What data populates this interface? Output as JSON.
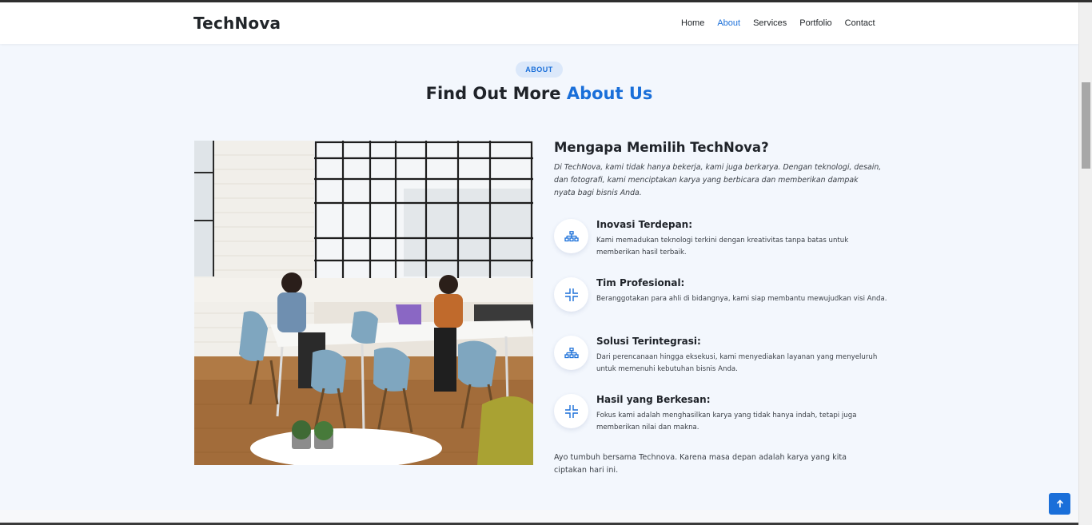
{
  "nav": {
    "brand": "TechNova",
    "links": [
      {
        "label": "Home",
        "active": false
      },
      {
        "label": "About",
        "active": true
      },
      {
        "label": "Services",
        "active": false
      },
      {
        "label": "Portfolio",
        "active": false
      },
      {
        "label": "Contact",
        "active": false
      }
    ]
  },
  "section": {
    "badge": "ABOUT",
    "title_plain": "Find Out More ",
    "title_accent": "About Us"
  },
  "about": {
    "heading": "Mengapa Memilih TechNova?",
    "intro": "Di TechNova, kami tidak hanya bekerja, kami juga berkarya. Dengan teknologi, desain, dan fotografi, kami menciptakan karya yang berbicara dan memberikan dampak nyata bagi bisnis Anda.",
    "features": [
      {
        "icon": "diagram-icon",
        "title": "Inovasi Terdepan:",
        "desc": "Kami memadukan teknologi terkini dengan kreativitas tanpa batas untuk memberikan hasil terbaik."
      },
      {
        "icon": "compress-icon",
        "title": "Tim Profesional:",
        "desc": "Beranggotakan para ahli di bidangnya, kami siap membantu mewujudkan visi Anda."
      },
      {
        "icon": "diagram-icon",
        "title": "Solusi Terintegrasi:",
        "desc": "Dari perencanaan hingga eksekusi, kami menyediakan layanan yang menyeluruh untuk memenuhi kebutuhan bisnis Anda."
      },
      {
        "icon": "compress-icon",
        "title": "Hasil yang Berkesan:",
        "desc": "Fokus kami adalah menghasilkan karya yang tidak hanya indah, tetapi juga memberikan nilai dan makna."
      }
    ],
    "outro": "Ayo tumbuh bersama Technova. Karena masa depan adalah karya yang kita ciptakan hari ini."
  },
  "colors": {
    "accent": "#1a6fd9",
    "background": "#f3f7fd",
    "heading": "#1f2329"
  },
  "photo": {
    "icon": "office-photo"
  },
  "back_to_top": {
    "icon": "arrow-up-icon"
  }
}
